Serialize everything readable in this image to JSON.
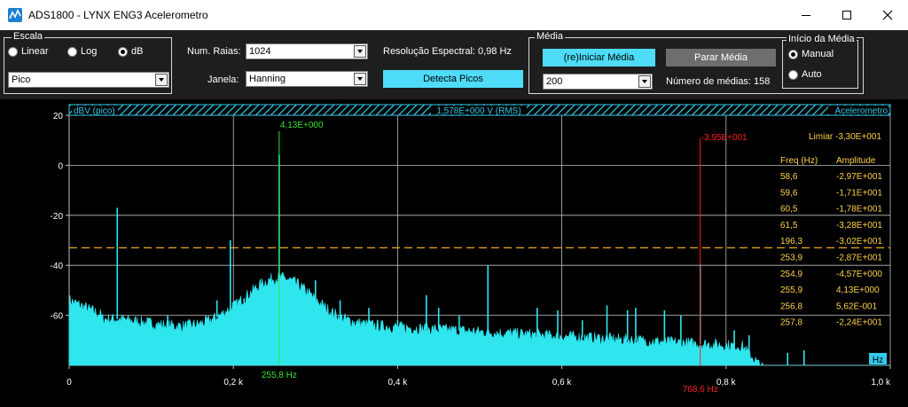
{
  "window": {
    "title": "ADS1800 - LYNX ENG3  Acelerometro"
  },
  "controls": {
    "escala": {
      "legend": "Escala",
      "options": [
        "Linear",
        "Log",
        "dB"
      ],
      "selected": "dB"
    },
    "detector_select": "Pico",
    "num_raias": {
      "label": "Num. Raias:",
      "value": "1024"
    },
    "janela": {
      "label": "Janela:",
      "value": "Hanning"
    },
    "resolucao": "Resolução Espectral: 0,98 Hz",
    "detecta_picos_label": "Detecta Picos",
    "media": {
      "legend": "Média",
      "reiniciar_label": "(re)Iniciar Média",
      "parar_label": "Parar Média",
      "count_select": "200",
      "numero_medias": "Número de médias: 158"
    },
    "inicio_media": {
      "legend": "Início da Média",
      "options": [
        "Manual",
        "Auto"
      ],
      "selected": "Manual"
    }
  },
  "plot": {
    "header_left": "dBV (pico)",
    "header_center": "1,578E+000 V (RMS)",
    "header_right": "Acelerometro",
    "unit_badge": "Hz",
    "limiar": "Limiar  -3,30E+001",
    "peak_table": {
      "headers": [
        "Freq (Hz)",
        "Amplitude"
      ],
      "rows": [
        [
          "58,6",
          "-2,97E+001"
        ],
        [
          "59,6",
          "-1,71E+001"
        ],
        [
          "60,5",
          "-1,78E+001"
        ],
        [
          "61,5",
          "-3,28E+001"
        ],
        [
          "196,3",
          "-3,02E+001"
        ],
        [
          "253,9",
          "-2,87E+001"
        ],
        [
          "254,9",
          "-4,57E+000"
        ],
        [
          "255,9",
          "4,13E+000"
        ],
        [
          "256,8",
          "5,62E-001"
        ],
        [
          "257,8",
          "-2,24E+001"
        ]
      ]
    },
    "cursor_green": {
      "freq_label": "255,8 Hz",
      "amp_label": "4,13E+000",
      "freq": 255.8,
      "amp": 4.13
    },
    "cursor_red": {
      "freq_label": "768,6 Hz",
      "amp_label": "-3,95E+001",
      "freq": 768.6,
      "amp": -39.5
    },
    "colors": {
      "spectrum": "#2fe6ee",
      "grid": "#bfbfbf",
      "threshold": "#e0a020",
      "green_cursor": "#34e434",
      "red_cursor": "#ff2020",
      "table_text": "#ffd24a",
      "header_cyan": "#32c8e8"
    }
  },
  "chart_data": {
    "type": "area",
    "xlabel": "",
    "ylabel": "",
    "xlim": [
      0,
      1000
    ],
    "ylim": [
      -80,
      20
    ],
    "x_ticks": [
      "0",
      "0,2 k",
      "0,4 k",
      "0,6 k",
      "0,8 k",
      "1,0 k"
    ],
    "x_tick_values": [
      0,
      200,
      400,
      600,
      800,
      1000
    ],
    "y_ticks": [
      "20",
      "0",
      "-20",
      "-40",
      "-60"
    ],
    "y_tick_values": [
      20,
      0,
      -20,
      -40,
      -60
    ],
    "threshold": -33,
    "grid": true,
    "peaks": [
      {
        "x": 58.6,
        "y": -17
      },
      {
        "x": 120,
        "y": -60
      },
      {
        "x": 180,
        "y": -54
      },
      {
        "x": 196.3,
        "y": -30
      },
      {
        "x": 213,
        "y": -57
      },
      {
        "x": 255.8,
        "y": 4.13
      },
      {
        "x": 275,
        "y": -55
      },
      {
        "x": 300,
        "y": -46
      },
      {
        "x": 330,
        "y": -54
      },
      {
        "x": 365,
        "y": -57
      },
      {
        "x": 400,
        "y": -62
      },
      {
        "x": 435,
        "y": -52
      },
      {
        "x": 450,
        "y": -57
      },
      {
        "x": 475,
        "y": -60
      },
      {
        "x": 510,
        "y": -40
      },
      {
        "x": 570,
        "y": -57
      },
      {
        "x": 595,
        "y": -58
      },
      {
        "x": 625,
        "y": -62
      },
      {
        "x": 655,
        "y": -56
      },
      {
        "x": 680,
        "y": -58
      },
      {
        "x": 690,
        "y": -57
      },
      {
        "x": 725,
        "y": -58
      },
      {
        "x": 745,
        "y": -60
      },
      {
        "x": 768.6,
        "y": -39.5
      },
      {
        "x": 810,
        "y": -66
      },
      {
        "x": 828,
        "y": -68
      },
      {
        "x": 875,
        "y": -75
      },
      {
        "x": 895,
        "y": -74
      }
    ]
  }
}
